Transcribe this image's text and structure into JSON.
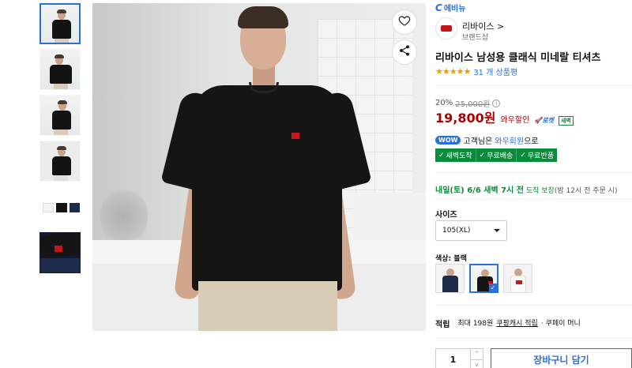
{
  "header": {
    "logo_c": "C",
    "logo_text": "에비뉴"
  },
  "brand": {
    "name": "리바이스 >",
    "shop": "브랜드샵"
  },
  "product": {
    "title": "리바이스 남성용 클래식 미네랄 티셔츠",
    "stars": "★★★★★",
    "rating": 4.5,
    "review_text": "31 개 상품평"
  },
  "price": {
    "discount": "20%",
    "original": "25,000원",
    "info_icon": "i",
    "final": "19,800원",
    "wow_sale": "와우할인",
    "rocket_label": "로켓",
    "dawn_badge": "새벽"
  },
  "wow": {
    "pill": "WOW",
    "prefix": "고객님은",
    "link": "와우회원",
    "suffix": "으로"
  },
  "benefits": [
    "새벽도착",
    "무료배송",
    "무료반품"
  ],
  "delivery": {
    "date": "내일(토) 6/6 새벽 7시 전",
    "guarantee": "도착 보장",
    "cutoff": "(밤 12시 전 주문 시)"
  },
  "size": {
    "label": "사이즈",
    "selected": "105(XL)"
  },
  "color": {
    "label": "색상: 블랙"
  },
  "swatches": [
    {
      "name": "navy",
      "color": "#1d2a4a"
    },
    {
      "name": "black",
      "color": "#151515",
      "selected": true
    },
    {
      "name": "white",
      "color": "#f4f4f4"
    }
  ],
  "cashback": {
    "label": "적립",
    "prefix": "최대 198원",
    "link": "쿠팡캐시 적립",
    "suffix": "· 쿠페이 머니"
  },
  "cart": {
    "quantity": "1",
    "up": "^",
    "down": "v",
    "button": "장바구니 담기"
  }
}
